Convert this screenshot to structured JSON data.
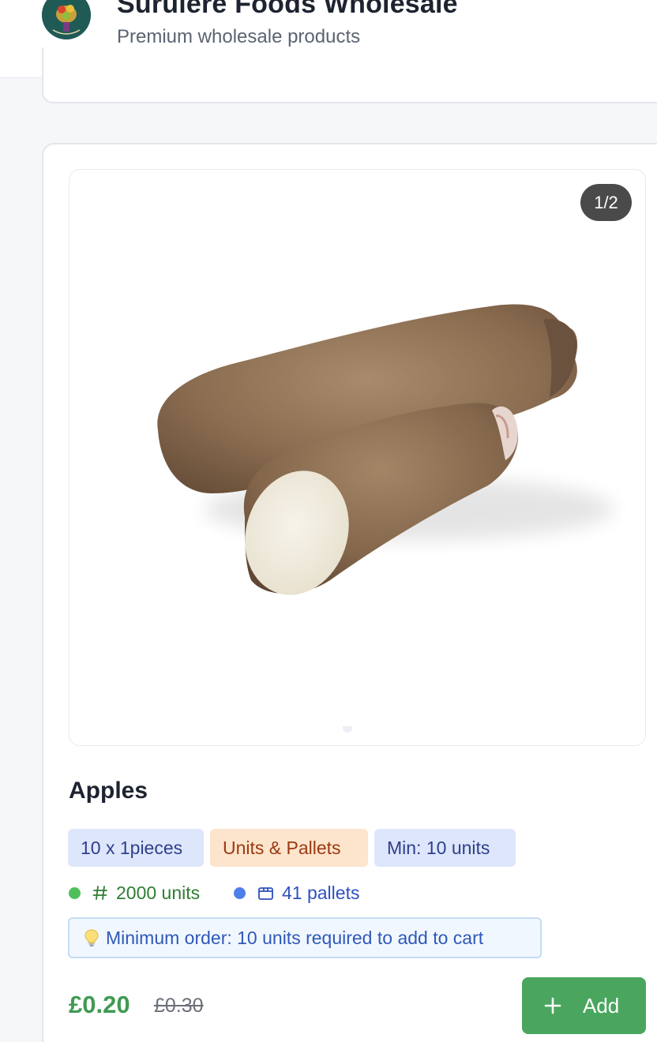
{
  "header": {
    "title": "Surulere Foods Wholesale",
    "subtitle": "Premium wholesale products"
  },
  "product": {
    "image_counter": "1/2",
    "name": "Apples",
    "chips": {
      "pack": "10 x 1pieces",
      "type": "Units & Pallets",
      "min": "Min: 10 units"
    },
    "stock": {
      "units": "2000 units",
      "pallets": "41 pallets"
    },
    "min_notice": "Minimum order: 10 units required to add to cart",
    "price": "£0.20",
    "old_price": "£0.30",
    "add_label": "Add"
  },
  "colors": {
    "price_green": "#3f9a53",
    "add_button": "#4aa65e",
    "pack_chip_bg": "#dde6fb",
    "type_chip_bg": "#fde4cc",
    "notice_bg": "#f1f7ff"
  },
  "icons": {
    "stock_units": "hash-icon",
    "stock_pallets": "package-icon",
    "notice": "lightbulb-icon",
    "add": "plus-icon"
  }
}
